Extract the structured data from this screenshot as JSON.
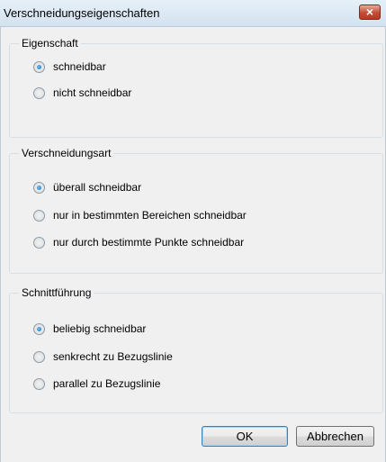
{
  "window": {
    "title": "Verschneidungseigenschaften",
    "close_icon": "×"
  },
  "groups": [
    {
      "legend": "Eigenschaft",
      "options": [
        {
          "label": "schneidbar",
          "checked": true
        },
        {
          "label": "nicht schneidbar",
          "checked": false
        }
      ]
    },
    {
      "legend": "Verschneidungsart",
      "options": [
        {
          "label": "überall schneidbar",
          "checked": true
        },
        {
          "label": "nur in bestimmten Bereichen schneidbar",
          "checked": false
        },
        {
          "label": "nur durch bestimmte Punkte schneidbar",
          "checked": false
        }
      ]
    },
    {
      "legend": "Schnittführung",
      "options": [
        {
          "label": "beliebig schneidbar",
          "checked": true
        },
        {
          "label": "senkrecht zu Bezugslinie",
          "checked": false
        },
        {
          "label": "parallel zu Bezugslinie",
          "checked": false
        }
      ]
    }
  ],
  "buttons": {
    "ok": "OK",
    "cancel": "Abbrechen"
  }
}
